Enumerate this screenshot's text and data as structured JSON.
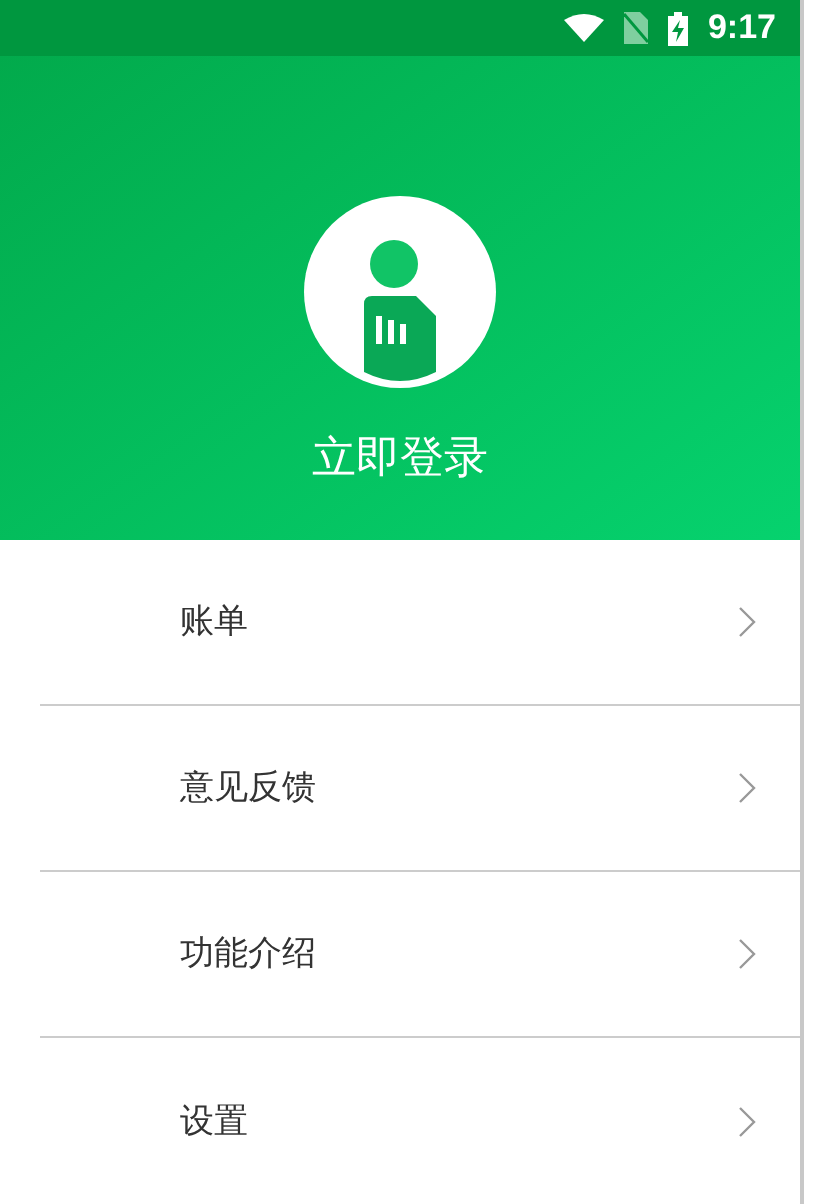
{
  "status_bar": {
    "time": "9:17"
  },
  "header": {
    "login_label": "立即登录"
  },
  "menu": [
    {
      "label": "账单"
    },
    {
      "label": "意见反馈"
    },
    {
      "label": "功能介绍"
    },
    {
      "label": "设置"
    }
  ]
}
